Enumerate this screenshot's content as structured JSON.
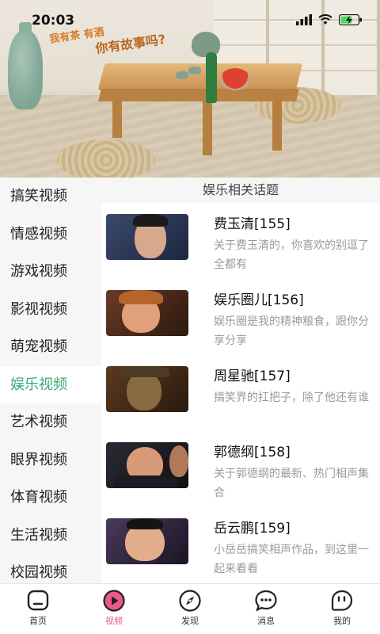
{
  "status_bar": {
    "time": "20:03"
  },
  "hero": {
    "text_line_1": "我有茶 有酒",
    "text_line_2": "你有故事吗?"
  },
  "sidebar": {
    "items": [
      {
        "label": "搞笑视频"
      },
      {
        "label": "情感视频"
      },
      {
        "label": "游戏视频"
      },
      {
        "label": "影视视频"
      },
      {
        "label": "萌宠视频"
      },
      {
        "label": "娱乐视频",
        "active": true
      },
      {
        "label": "艺术视频"
      },
      {
        "label": "眼界视频"
      },
      {
        "label": "体育视频"
      },
      {
        "label": "生活视频"
      },
      {
        "label": "校园视频"
      }
    ]
  },
  "content": {
    "section_title": "娱乐相关话题",
    "topics": [
      {
        "title": "费玉清[155]",
        "desc": "关于费玉清的，你喜欢的别逗了全都有"
      },
      {
        "title": "娱乐圈儿[156]",
        "desc": "娱乐圈是我的精神粮食，跟你分享分享"
      },
      {
        "title": "周星驰[157]",
        "desc": "搞笑界的扛把子，除了他还有谁"
      },
      {
        "title": "郭德纲[158]",
        "desc": "关于郭德纲的最新、热门相声集合"
      },
      {
        "title": "岳云鹏[159]",
        "desc": "小岳岳搞笑相声作品，到这里一起来看看"
      }
    ]
  },
  "tabbar": {
    "tabs": [
      {
        "label": "首页",
        "icon": "home-icon"
      },
      {
        "label": "视频",
        "icon": "play-icon",
        "active": true
      },
      {
        "label": "发现",
        "icon": "compass-icon"
      },
      {
        "label": "消息",
        "icon": "chat-icon"
      },
      {
        "label": "我的",
        "icon": "profile-icon"
      }
    ]
  },
  "colors": {
    "accent_green": "#3aa873",
    "accent_pink": "#e95b86",
    "sidebar_bg": "#f6f6f6"
  }
}
